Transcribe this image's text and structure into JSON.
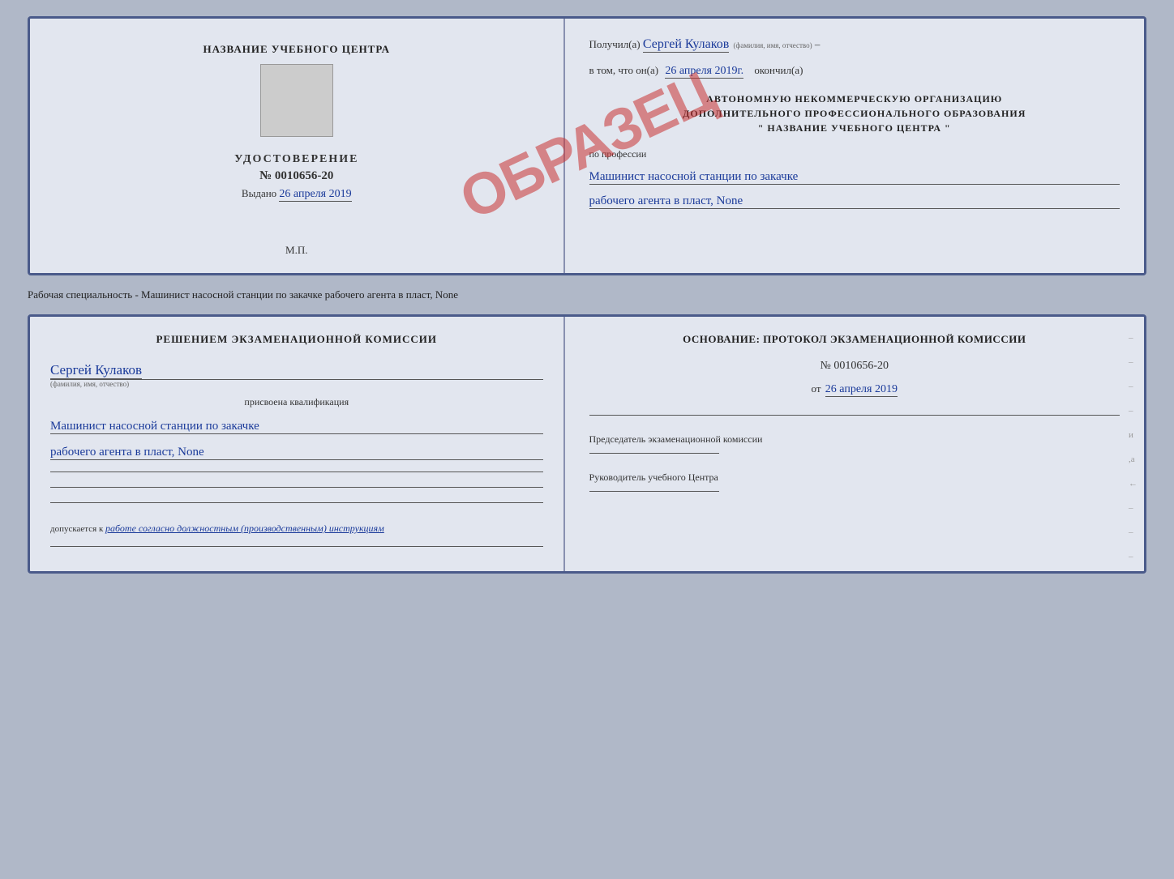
{
  "doc1": {
    "left": {
      "center_title": "НАЗВАНИЕ УЧЕБНОГО ЦЕНТРА",
      "udostoverenie_label": "УДОСТОВЕРЕНИЕ",
      "udostoverenie_num": "№ 0010656-20",
      "vydano_label": "Выдано",
      "vydano_date": "26 апреля 2019",
      "mp_label": "М.П."
    },
    "right": {
      "poluchil_label": "Получил(а)",
      "recipient_name": "Сергей Кулаков",
      "recipient_hint": "(фамилия, имя, отчество)",
      "v_tom_label": "в том, что он(а)",
      "date_completed": "26 апреля 2019г.",
      "okonchil_label": "окончил(а)",
      "org_line1": "АВТОНОМНУЮ НЕКОММЕРЧЕСКУЮ ОРГАНИЗАЦИЮ",
      "org_line2": "ДОПОЛНИТЕЛЬНОГО ПРОФЕССИОНАЛЬНОГО ОБРАЗОВАНИЯ",
      "org_line3": "\"  НАЗВАНИЕ УЧЕБНОГО ЦЕНТРА  \"",
      "po_professii_label": "по профессии",
      "profession_line1": "Машинист насосной станции по закачке",
      "profession_line2": "рабочего агента в пласт, None"
    }
  },
  "info_text": "Рабочая специальность - Машинист насосной станции по закачке рабочего агента в пласт,\nNone",
  "doc2": {
    "left": {
      "resheniem_title": "Решением экзаменационной комиссии",
      "recipient_name": "Сергей Кулаков",
      "recipient_hint": "(фамилия, имя, отчество)",
      "prisvoena_label": "присвоена квалификация",
      "profession_line1": "Машинист насосной станции по закачке",
      "profession_line2": "рабочего агента в пласт, None",
      "dopuskaetsya_label": "допускается к",
      "dopusk_text": "работе согласно должностным (производственным) инструкциям"
    },
    "right": {
      "osnovanie_label": "Основание: протокол экзаменационной комиссии",
      "protocol_num": "№ 0010656-20",
      "protocol_date_prefix": "от",
      "protocol_date": "26 апреля 2019",
      "predsedatel_label": "Председатель экзаменационной комиссии",
      "rukovoditel_label": "Руководитель учебного Центра"
    }
  },
  "stamp": {
    "obrazets_text": "ОБРАЗЕЦ"
  }
}
